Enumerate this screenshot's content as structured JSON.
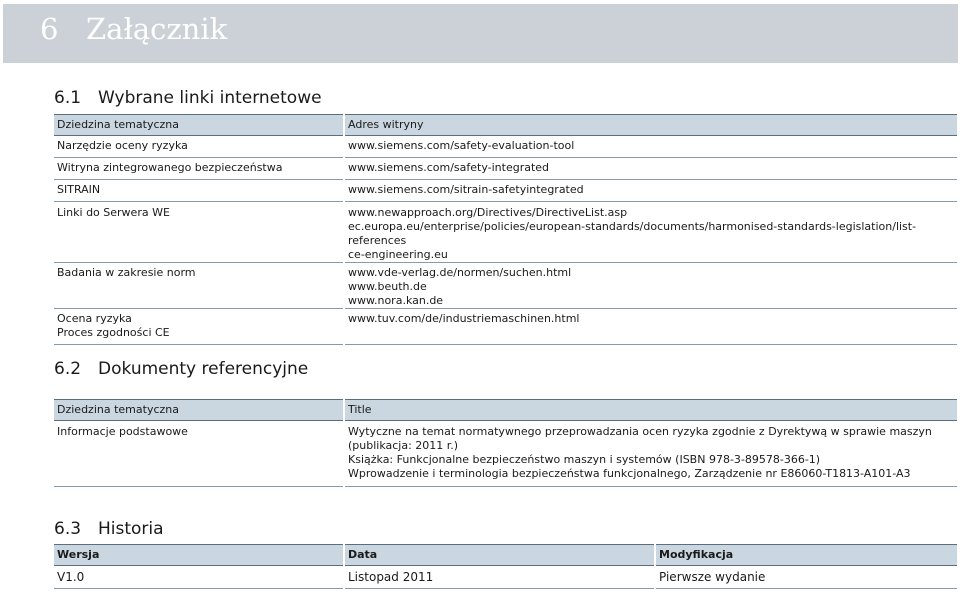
{
  "header": {
    "number": "6",
    "title": "Załącznik"
  },
  "section1": {
    "number": "6.1",
    "title": "Wybrane linki internetowe",
    "col1": "Dziedzina tematyczna",
    "col2": "Adres witryny",
    "rows": [
      {
        "topic": [
          "Narzędzie oceny ryzyka"
        ],
        "urls": [
          "www.siemens.com/safety-evaluation-tool"
        ]
      },
      {
        "topic": [
          "Witryna zintegrowanego bezpieczeństwa"
        ],
        "urls": [
          "www.siemens.com/safety-integrated"
        ]
      },
      {
        "topic": [
          "SITRAIN"
        ],
        "urls": [
          "www.siemens.com/sitrain-safetyintegrated"
        ]
      },
      {
        "topic": [
          "Linki do Serwera WE"
        ],
        "urls": [
          "www.newapproach.org/Directives/DirectiveList.asp",
          "ec.europa.eu/enterprise/policies/european-standards/documents/harmonised-standards-legislation/list-references",
          "ce-engineering.eu"
        ]
      },
      {
        "topic": [
          "Badania w zakresie norm"
        ],
        "urls": [
          "www.vde-verlag.de/normen/suchen.html",
          "www.beuth.de",
          "www.nora.kan.de"
        ]
      },
      {
        "topic": [
          "Ocena ryzyka",
          "Proces zgodności CE"
        ],
        "urls": [
          "www.tuv.com/de/industriemaschinen.html"
        ]
      }
    ]
  },
  "section2": {
    "number": "6.2",
    "title": "Dokumenty referencyjne",
    "col1": "Dziedzina tematyczna",
    "col2": "Title",
    "rows": [
      {
        "topic": "Informacje podstawowe",
        "lines": [
          "Wytyczne na temat normatywnego przeprowadzania ocen ryzyka zgodnie z Dyrektywą w sprawie maszyn",
          "(publikacja: 2011 r.)",
          "Książka: Funkcjonalne bezpieczeństwo maszyn i systemów (ISBN 978-3-89578-366-1)",
          "Wprowadzenie i terminologia bezpieczeństwa funkcjonalnego, Zarządzenie nr E86060-T1813-A101-A3"
        ]
      }
    ]
  },
  "section3": {
    "number": "6.3",
    "title": "Historia",
    "col1": "Wersja",
    "col2": "Data",
    "col3": "Modyfikacja",
    "rows": [
      {
        "version": "V1.0",
        "date": "Listopad 2011",
        "modification": "Pierwsze wydanie"
      }
    ]
  }
}
